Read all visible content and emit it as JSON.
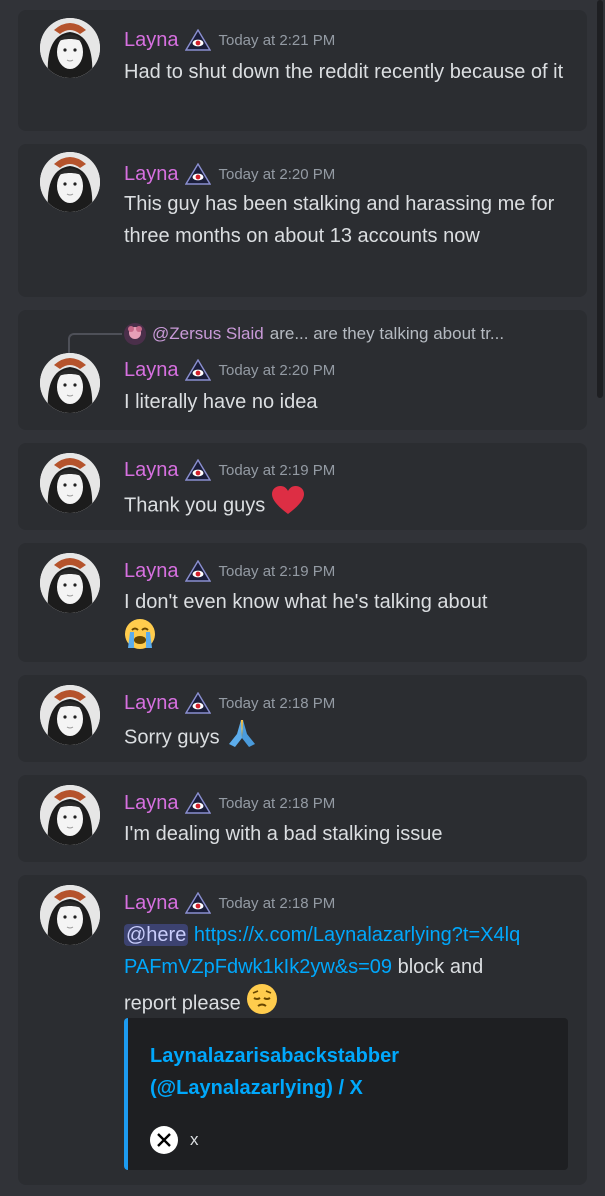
{
  "messages": [
    {
      "author": "Layna",
      "timestamp": "Today at 2:21 PM",
      "text": "Had to shut down the reddit recently because of it"
    },
    {
      "author": "Layna",
      "timestamp": "Today at 2:20 PM",
      "text": "This guy has been stalking and harassing me for three months on about 13 accounts now"
    },
    {
      "author": "Layna",
      "timestamp": "Today at 2:20 PM",
      "text": "I literally have no idea",
      "reply": {
        "name": "@Zersus Slaid",
        "preview": "are... are they talking about tr..."
      }
    },
    {
      "author": "Layna",
      "timestamp": "Today at 2:19 PM",
      "text": "Thank you guys",
      "emoji": "red-heart"
    },
    {
      "author": "Layna",
      "timestamp": "Today at 2:19 PM",
      "text": "I don't even know what he's talking about",
      "emoji": "loudly-crying-face"
    },
    {
      "author": "Layna",
      "timestamp": "Today at 2:18 PM",
      "text": "Sorry guys",
      "emoji": "folded-hands"
    },
    {
      "author": "Layna",
      "timestamp": "Today at 2:18 PM",
      "text": "I'm dealing with a bad stalking issue"
    },
    {
      "author": "Layna",
      "timestamp": "Today at 2:18 PM",
      "mention": "@here",
      "link": "https://x.com/Laynalazarlying?t=X4lqPAFmVZpFdwk1kIk2yw&s=09",
      "text_after": "block and report please",
      "emoji": "pensive-face",
      "embed": {
        "title": "Laynalazarisabackstabber (@Laynalazarlying) / X",
        "footer": "x",
        "provider_icon": "x-logo-icon",
        "accent": "#1d9bf0"
      }
    }
  ],
  "colors": {
    "background": "#313338",
    "card": "#2b2d31",
    "username": "#d770e0",
    "link": "#00a8fc",
    "timestamp": "#949ba4"
  }
}
